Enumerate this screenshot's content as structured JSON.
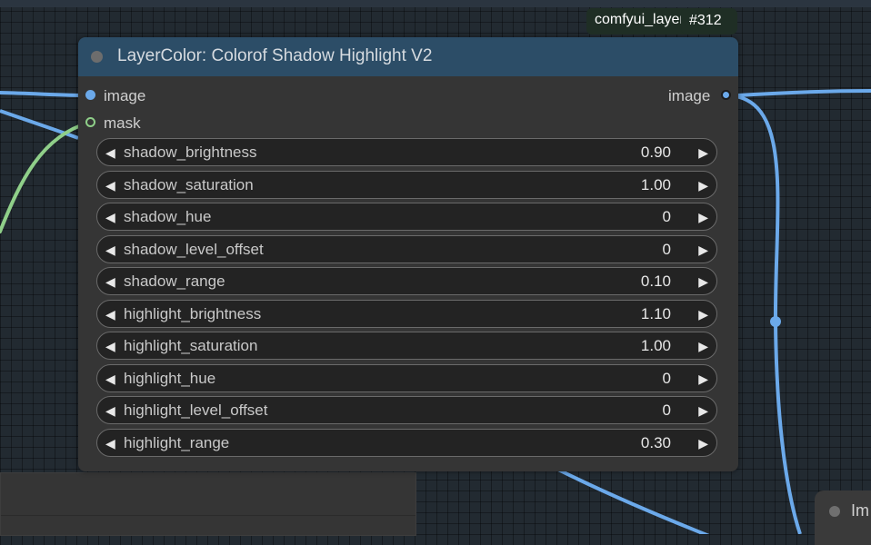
{
  "node": {
    "title": "LayerColor: Colorof Shadow Highlight V2",
    "badge_name": "comfyui_layerstyle",
    "badge_id": "#312",
    "inputs": [
      {
        "label": "image",
        "color": "#6ba9ea"
      },
      {
        "label": "mask",
        "color": "#8fcf89"
      }
    ],
    "outputs": [
      {
        "label": "image",
        "color": "#6ba9ea"
      }
    ],
    "widgets": [
      {
        "name": "shadow_brightness",
        "value": "0.90"
      },
      {
        "name": "shadow_saturation",
        "value": "1.00"
      },
      {
        "name": "shadow_hue",
        "value": "0"
      },
      {
        "name": "shadow_level_offset",
        "value": "0"
      },
      {
        "name": "shadow_range",
        "value": "0.10"
      },
      {
        "name": "highlight_brightness",
        "value": "1.10"
      },
      {
        "name": "highlight_saturation",
        "value": "1.00"
      },
      {
        "name": "highlight_hue",
        "value": "0"
      },
      {
        "name": "highlight_level_offset",
        "value": "0"
      },
      {
        "name": "highlight_range",
        "value": "0.30"
      }
    ],
    "arrow_left": "◀",
    "arrow_right": "▶"
  },
  "offscreen_node": {
    "title_partial": "Im"
  },
  "colors": {
    "canvas": "#222a31",
    "node_body": "#353535",
    "node_header": "#2c4d67",
    "link_image": "#6ba9ea",
    "link_mask": "#8fcf89"
  }
}
